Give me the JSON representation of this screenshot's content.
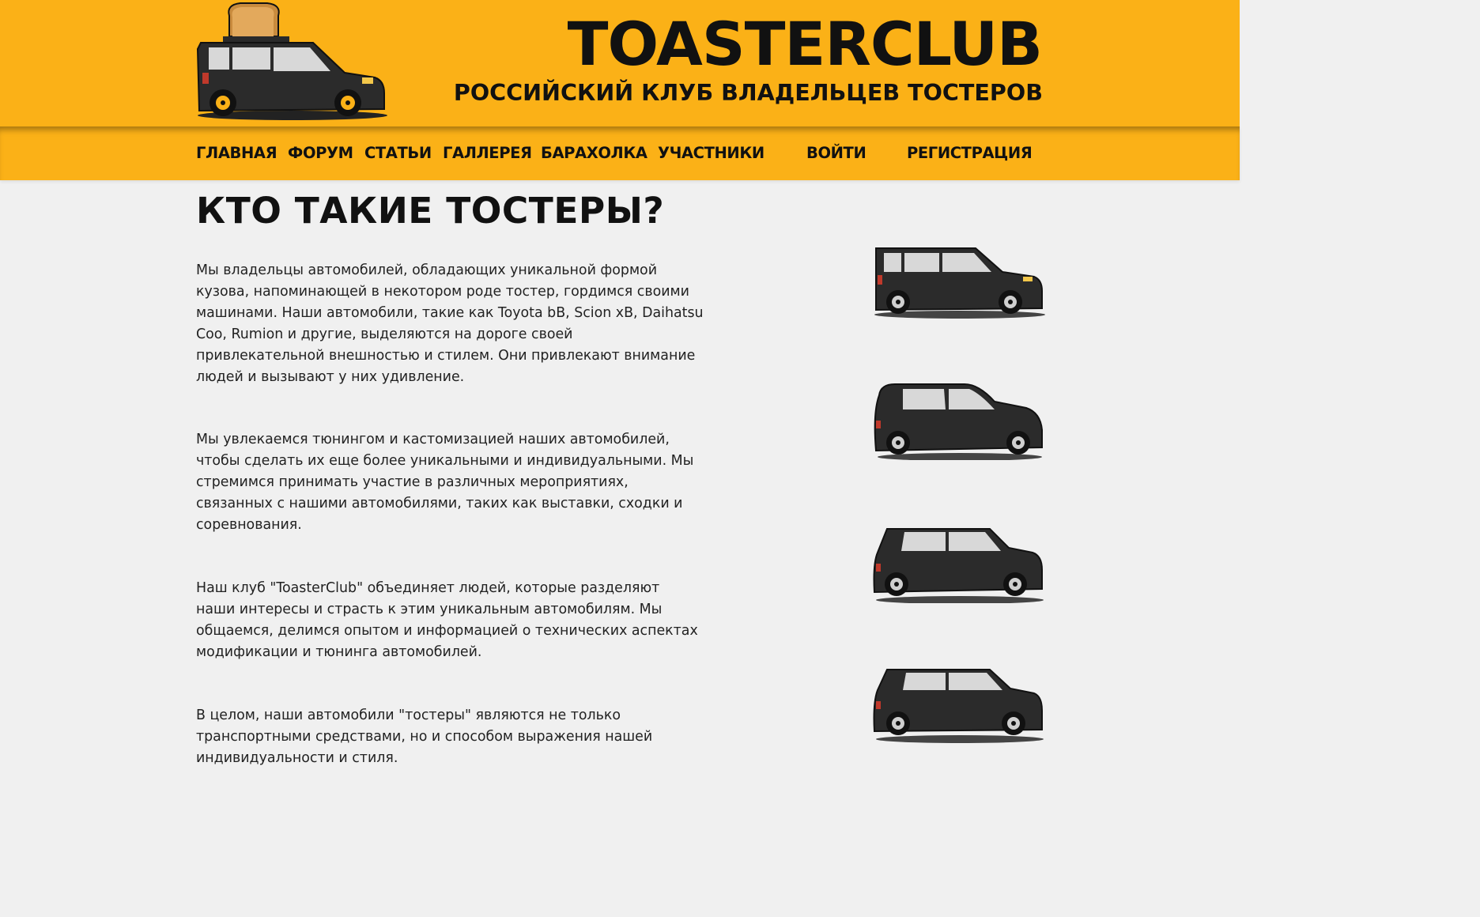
{
  "header": {
    "title": "TOASTERCLUB",
    "subtitle": "РОССИЙСКИЙ КЛУБ ВЛАДЕЛЬЦЕВ ТОСТЕРОВ",
    "logo_icon": "toaster-car-icon"
  },
  "nav": {
    "items": [
      "ГЛАВНАЯ",
      "ФОРУМ",
      "СТАТЬИ",
      "ГАЛЛЕРЕЯ",
      "БАРАХОЛКА",
      "УЧАСТНИКИ"
    ],
    "login": "ВОЙТИ",
    "register": "РЕГИСТРАЦИЯ"
  },
  "main": {
    "title": "КТО ТАКИЕ ТОСТЕРЫ?",
    "paragraphs": [
      "Мы владельцы автомобилей, обладающих уникальной формой\nкузова, напоминающей в некотором роде тостер, гордимся своими\nмашинами. Наши автомобили, такие как Toyota bB, Scion xB, Daihatsu\nCoo, Rumion и другие, выделяются на дороге своей\nпривлекательной внешностью и стилем. Они привлекают внимание\nлюдей и вызывают у них удивление.",
      "Мы увлекаемся тюнингом и кастомизацией наших автомобилей,\nчтобы сделать их еще более уникальными и индивидуальными. Мы\nстремимся принимать участие в различных мероприятиях,\nсвязанных с нашими автомобилями, таких как выставки, сходки и\nсоревнования.",
      "Наш клуб \"ToasterClub\" объединяет людей, которые разделяют\nнаши интересы и страсть к этим уникальным автомобилям. Мы\nобщаемся, делимся опытом и информацией о технических аспектах\nмодификации и тюнинга автомобилей.",
      "В целом, наши автомобили \"тостеры\" являются не только\nтранспортными средствами, но и способом выражения нашей\nиндивидуальности и стиля."
    ],
    "car_images": [
      "boxy-car-icon",
      "rounded-car-icon",
      "compact-car-icon",
      "compact-car-icon"
    ]
  },
  "colors": {
    "accent": "#fbb117",
    "background": "#f0f0f0",
    "car_body": "#2b2b2b",
    "car_window": "#d8d8d8"
  }
}
